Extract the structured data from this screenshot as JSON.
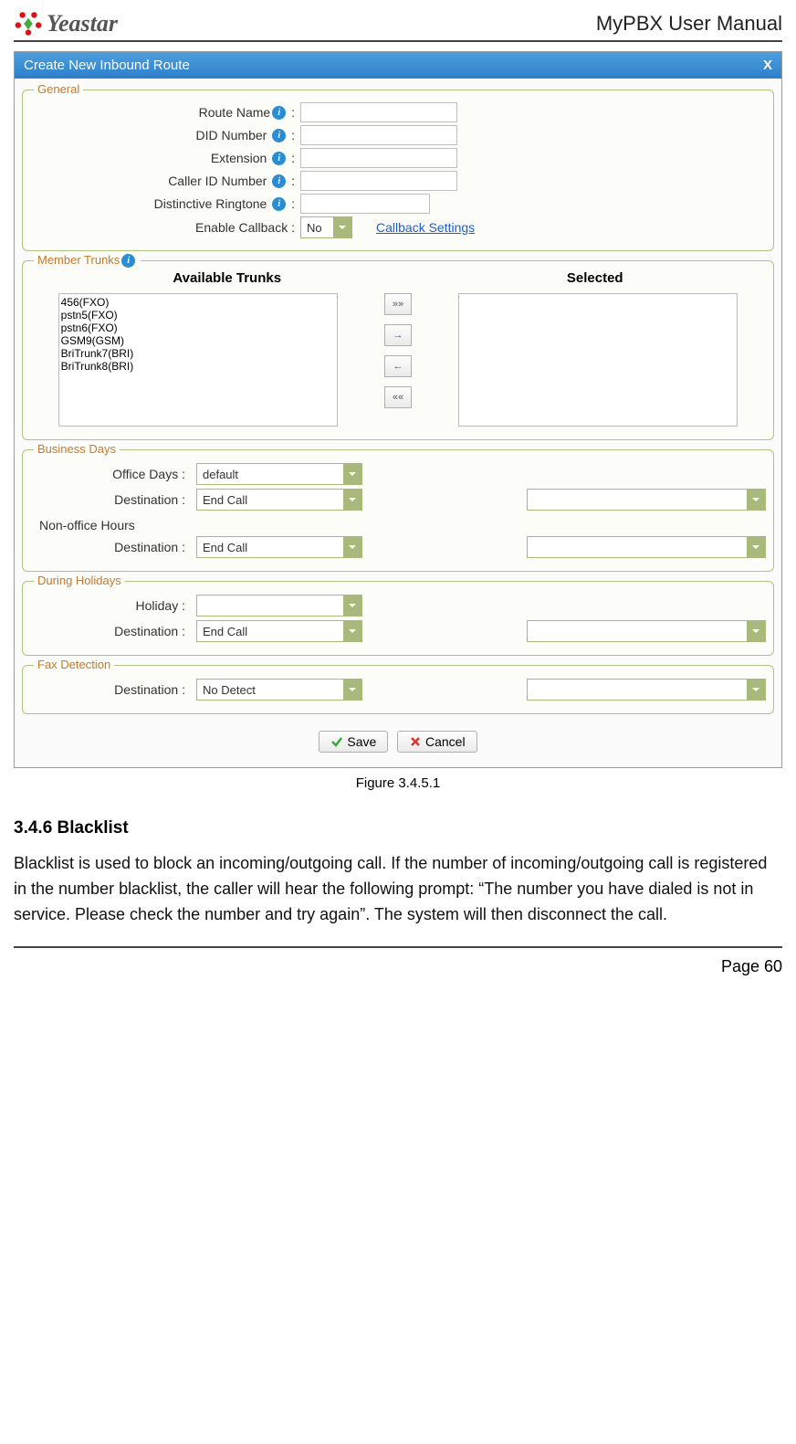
{
  "header": {
    "logo_text": "Yeastar",
    "doc_title": "MyPBX User Manual"
  },
  "modal": {
    "title": "Create New Inbound Route",
    "close": "X"
  },
  "general": {
    "legend": "General",
    "route_name_label": "Route Name",
    "did_number_label": "DID Number",
    "extension_label": "Extension",
    "caller_id_label": "Caller ID Number",
    "distinctive_ringtone_label": "Distinctive Ringtone",
    "enable_callback_label": "Enable Callback",
    "enable_callback_value": "No",
    "callback_settings_link": "Callback Settings",
    "colon": ":"
  },
  "member_trunks": {
    "legend": "Member Trunks",
    "available_header": "Available Trunks",
    "selected_header": "Selected",
    "available": [
      "456(FXO)",
      "pstn5(FXO)",
      "pstn6(FXO)",
      "GSM9(GSM)",
      "BriTrunk7(BRI)",
      "BriTrunk8(BRI)"
    ],
    "btn_all_right": "»»",
    "btn_right": "→",
    "btn_left": "←",
    "btn_all_left": "««"
  },
  "business_days": {
    "legend": "Business Days",
    "office_days_label": "Office Days",
    "office_days_value": "default",
    "destination_label": "Destination",
    "destination_value": "End Call",
    "non_office_label": "Non-office Hours",
    "non_office_dest_value": "End Call"
  },
  "during_holidays": {
    "legend": "During Holidays",
    "holiday_label": "Holiday",
    "holiday_value": "",
    "destination_label": "Destination",
    "destination_value": "End Call"
  },
  "fax": {
    "legend": "Fax Detection",
    "destination_label": "Destination",
    "destination_value": "No Detect"
  },
  "actions": {
    "save": "Save",
    "cancel": "Cancel"
  },
  "caption": "Figure 3.4.5.1",
  "section": {
    "title": "3.4.6 Blacklist",
    "paragraph": "Blacklist is used to block an incoming/outgoing call. If the number of incoming/outgoing call is registered in the number blacklist, the caller will hear the following prompt: “The number you have dialed is not in service. Please check the number and try again”. The system will then disconnect the call."
  },
  "footer": {
    "page": "Page 60"
  },
  "colon": ":"
}
